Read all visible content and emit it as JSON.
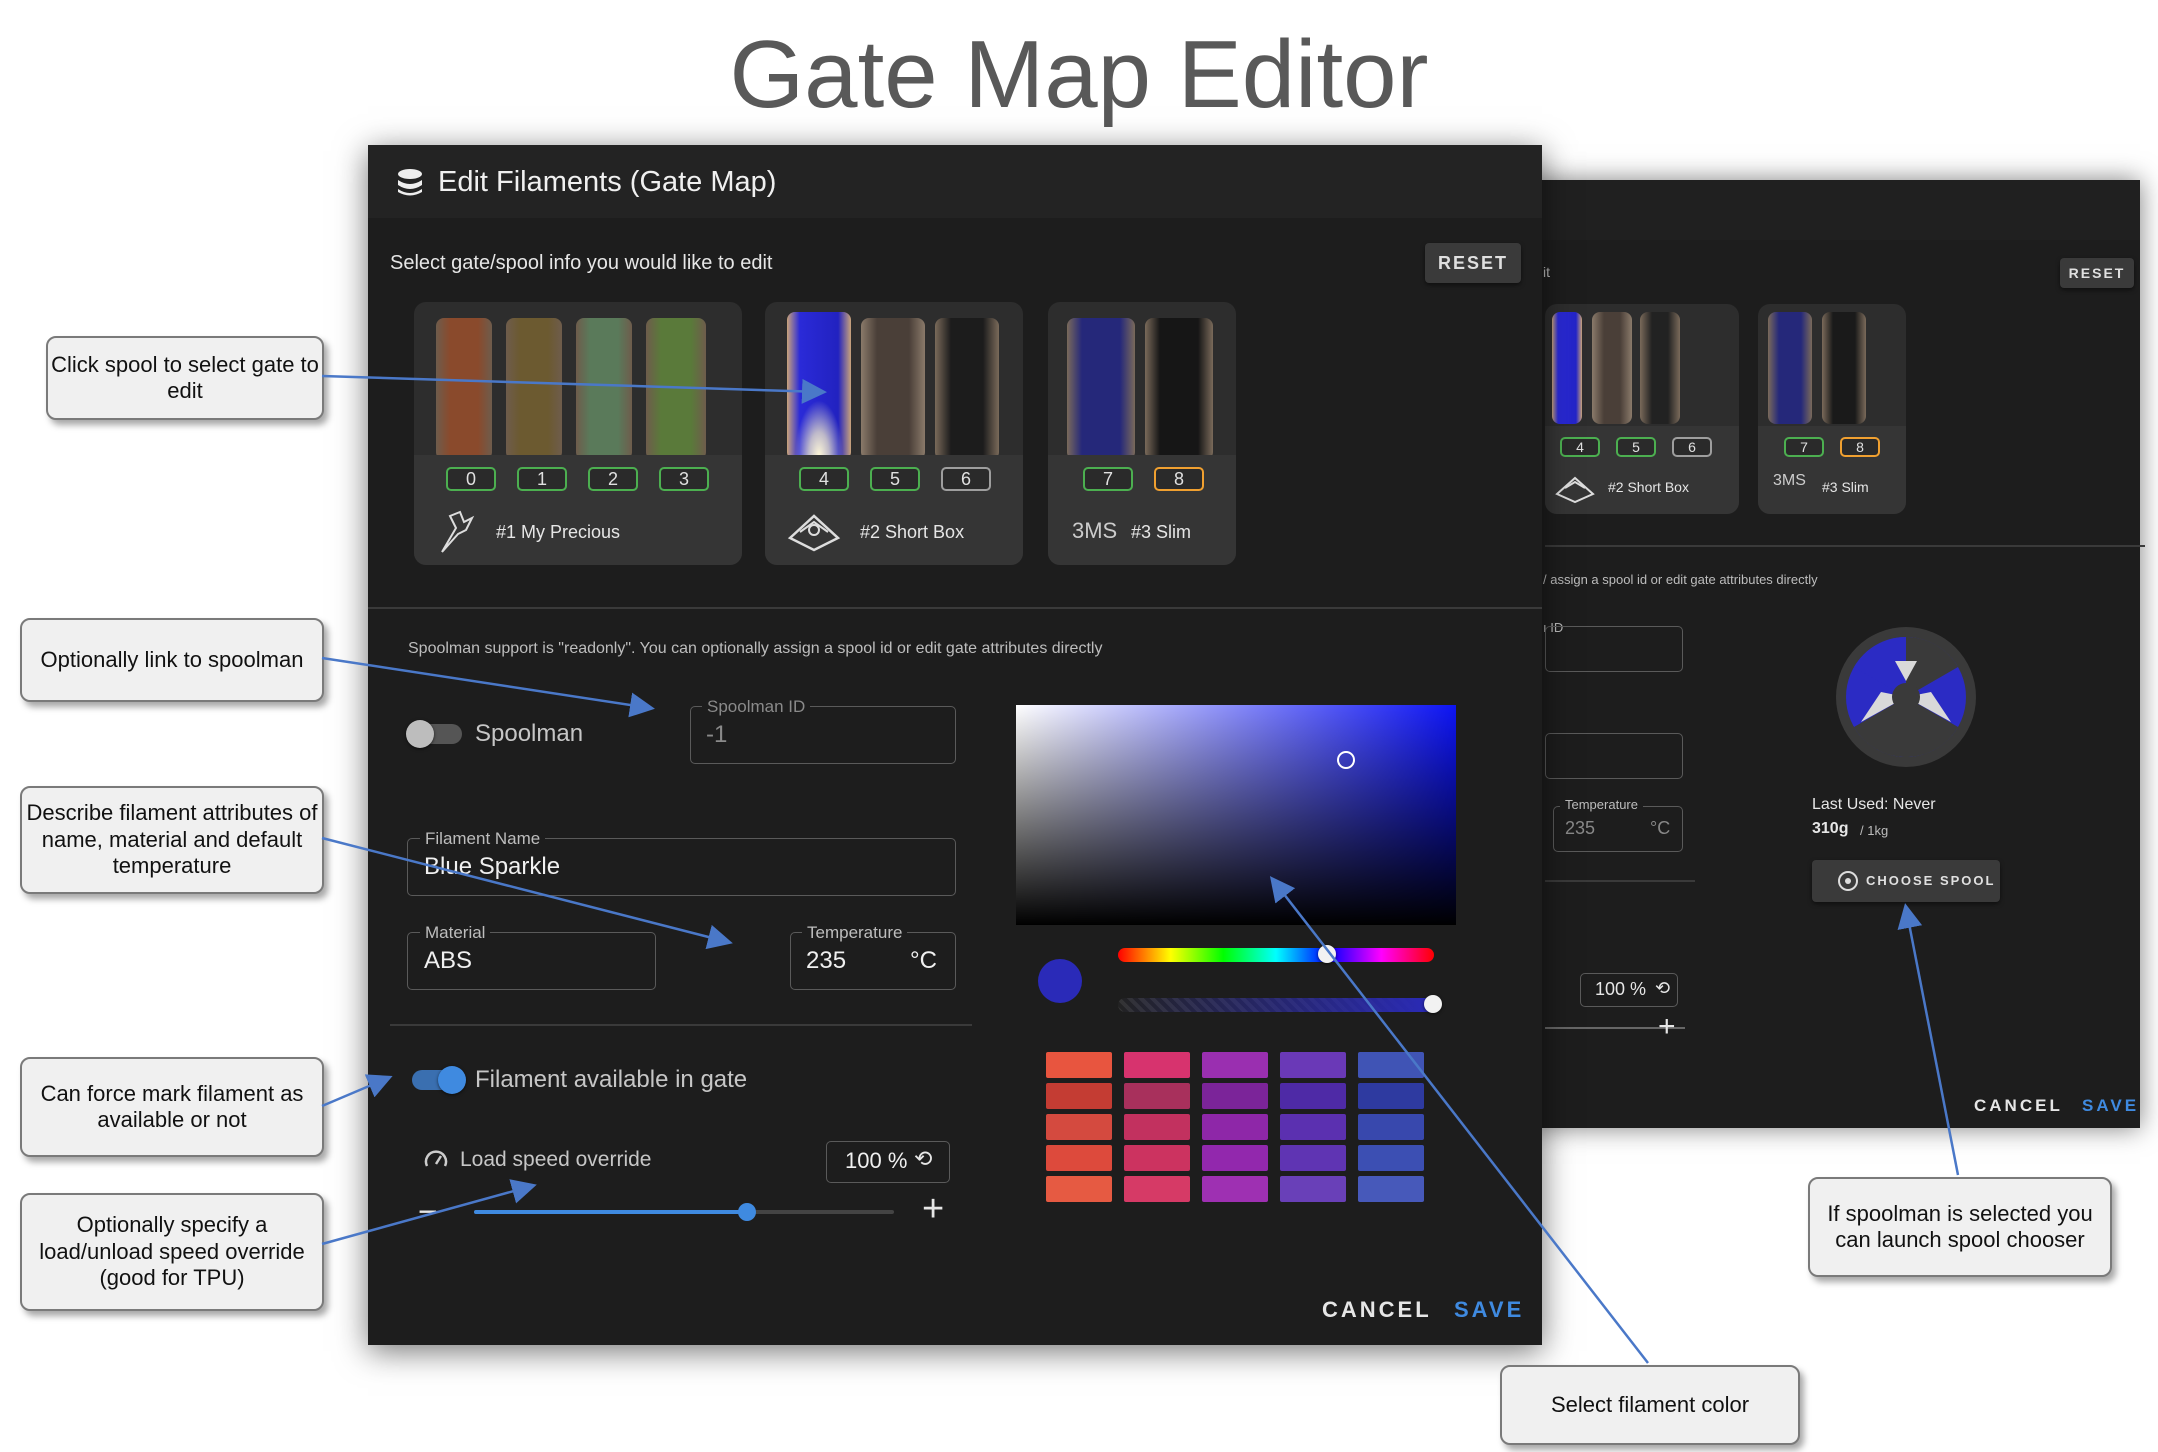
{
  "page_title": "Gate Map Editor",
  "dialog": {
    "title": "Edit Filaments (Gate Map)",
    "subtitle": "Select gate/spool info you would like to edit",
    "reset_label": "RESET",
    "units": [
      {
        "name": "#1 My Precious",
        "gates": [
          "0",
          "1",
          "2",
          "3"
        ],
        "icon": "dragon-icon"
      },
      {
        "name": "#2 Short Box",
        "gates": [
          "4",
          "5",
          "6"
        ],
        "icon": "box-turtle-icon"
      },
      {
        "name": "#3 Slim",
        "gates": [
          "7",
          "8"
        ],
        "icon": "3ms-logo-icon",
        "logo_text": "3MS"
      }
    ],
    "spoolman_note": "Spoolman support is \"readonly\". You can optionally assign a spool id or edit gate attributes directly",
    "spoolman_toggle_label": "Spoolman",
    "spoolman_enabled": false,
    "spoolman_id_label": "Spoolman ID",
    "spoolman_id_value": "-1",
    "filament_name_label": "Filament Name",
    "filament_name_value": "Blue Sparkle",
    "material_label": "Material",
    "material_value": "ABS",
    "temperature_label": "Temperature",
    "temperature_value": "235",
    "temperature_unit": "°C",
    "available_label": "Filament available in gate",
    "available_enabled": true,
    "speed_label": "Load speed override",
    "speed_value": "100 %",
    "speed_fraction": 0.65,
    "minus_label": "−",
    "plus_label": "+",
    "cancel_label": "CANCEL",
    "save_label": "SAVE",
    "selected_color": "#2a2ab8",
    "swatches": [
      [
        "#e8553f",
        "#d7336e",
        "#9a2fb0",
        "#6a39b7",
        "#4054b5"
      ],
      [
        "#c43c33",
        "#a8305c",
        "#7b2499",
        "#4e2aa6",
        "#2e3aa0"
      ],
      [
        "#d44a3f",
        "#c2315f",
        "#8e27a8",
        "#5b30b0",
        "#3848ad"
      ],
      [
        "#dd4a3c",
        "#cc3360",
        "#9228ad",
        "#5f34b3",
        "#3c4fb3"
      ],
      [
        "#e65a42",
        "#d63a66",
        "#9e30b2",
        "#6940b8",
        "#4759ba"
      ]
    ]
  },
  "back_dialog": {
    "subtitle_fragment": "it",
    "reset_label": "RESET",
    "units": [
      {
        "name": "#2 Short Box",
        "gates": [
          "4",
          "5",
          "6"
        ]
      },
      {
        "name": "#3 Slim",
        "gates": [
          "7",
          "8"
        ],
        "logo_text": "3MS"
      }
    ],
    "note_fragment": "/ assign a spool id or edit gate attributes directly",
    "id_label_fragment": "ı ID",
    "temperature_label": "Temperature",
    "temperature_value": "235",
    "temperature_unit": "°C",
    "last_used": "Last Used: Never",
    "weight": "310g",
    "weight_total": "/ 1kg",
    "choose_spool_label": "CHOOSE SPOOL",
    "speed_value": "100 %",
    "plus_label": "+",
    "cancel_label": "CANCEL",
    "save_label": "SAVE"
  },
  "callouts": {
    "select_gate": "Click spool to select gate to edit",
    "spoolman_link": "Optionally link to spoolman",
    "attributes": "Describe filament attributes of name, material and default temperature",
    "force_mark": "Can force mark filament as available or not",
    "speed_override": "Optionally specify a load/unload speed override (good for TPU)",
    "spool_chooser": "If spoolman is selected you can launch spool chooser",
    "color": "Select filament color"
  }
}
